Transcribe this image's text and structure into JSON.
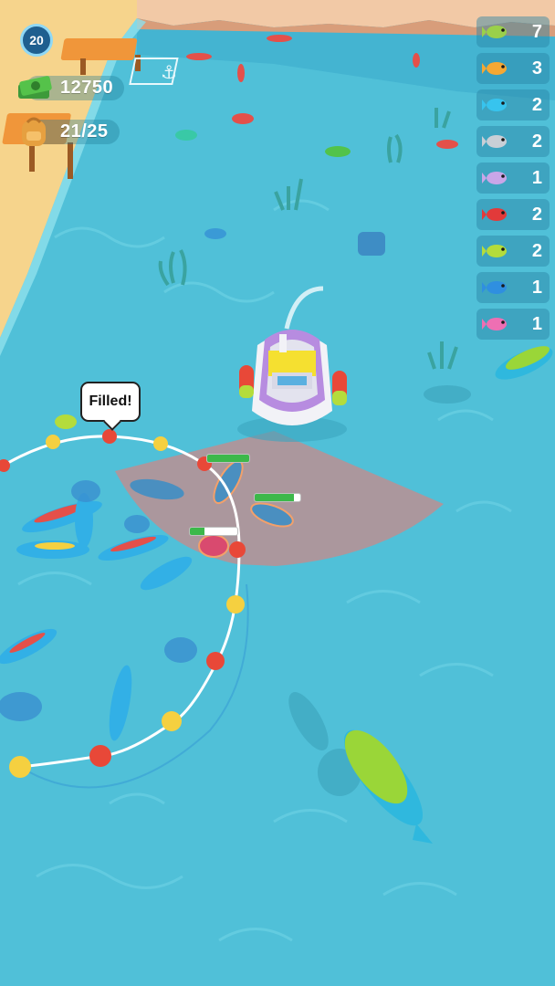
{
  "hud": {
    "level": "20",
    "money": "12750",
    "capacity": "21/25"
  },
  "speech_bubble": "Filled!",
  "fish_counts": [
    {
      "icon": "green-fish-icon",
      "count": "7",
      "color": "#9ad04a"
    },
    {
      "icon": "orange-fish-icon",
      "count": "3",
      "color": "#f5a833"
    },
    {
      "icon": "blue-fish-icon",
      "count": "2",
      "color": "#37c4ee"
    },
    {
      "icon": "grey-dolphin-icon",
      "count": "2",
      "color": "#c9cfd6"
    },
    {
      "icon": "purple-fish-icon",
      "count": "1",
      "color": "#c9a6e8"
    },
    {
      "icon": "red-fish-icon",
      "count": "2",
      "color": "#e23a3a"
    },
    {
      "icon": "lime-fish-icon",
      "count": "2",
      "color": "#b4dc3c"
    },
    {
      "icon": "striped-fish-icon",
      "count": "1",
      "color": "#2f8fe0"
    },
    {
      "icon": "pink-fish-icon",
      "count": "1",
      "color": "#ee6fb3"
    }
  ],
  "catch_progress": [
    {
      "target": "fish-1",
      "progress": 1.0
    },
    {
      "target": "fish-2",
      "progress": 0.85
    },
    {
      "target": "fish-3",
      "progress": 0.3
    }
  ],
  "colors": {
    "water": "#4fbfd6",
    "sand": "#f6d48c",
    "boat_hull": "#b78ce0",
    "net_range": "#c98a8a"
  }
}
